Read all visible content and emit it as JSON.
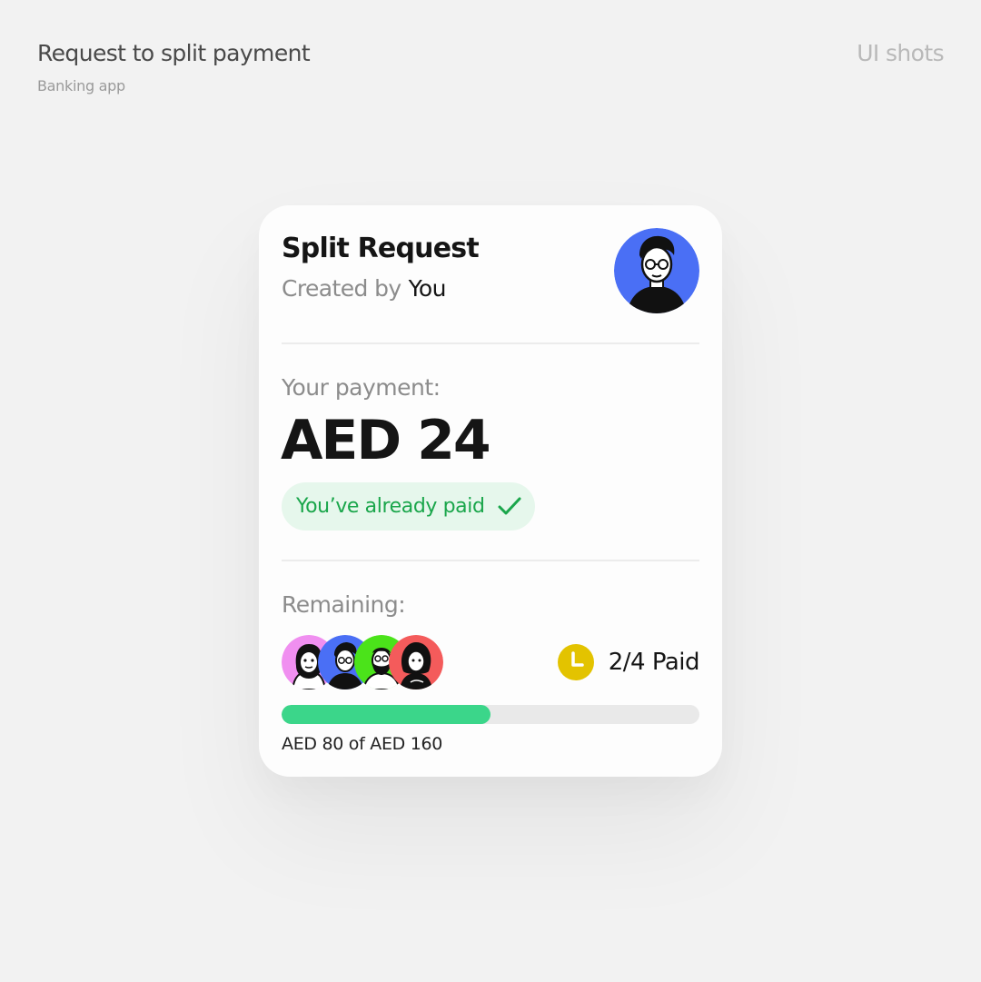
{
  "header": {
    "title": "Request to split payment",
    "subtitle": "Banking app",
    "brand": "UI shots"
  },
  "card": {
    "title": "Split Request",
    "created_by_label": "Created by",
    "created_by_value": "You",
    "owner_avatar_icon": "person-avatar-icon",
    "payment_label": "Your payment:",
    "payment_amount": "AED 24",
    "paid_badge": {
      "text": "You’ve already paid",
      "icon": "check-icon",
      "color": "#1aa64b",
      "background": "#e6f7ec"
    },
    "remaining_label": "Remaining:",
    "participants": [
      {
        "icon": "participant-avatar-icon",
        "color": "#f08ff0"
      },
      {
        "icon": "participant-avatar-icon",
        "color": "#4a6ff5"
      },
      {
        "icon": "participant-avatar-icon",
        "color": "#4be31a"
      },
      {
        "icon": "participant-avatar-icon",
        "color": "#f45b5b"
      }
    ],
    "status": {
      "icon": "clock-icon",
      "icon_color": "#e3c300",
      "text": "2/4 Paid"
    },
    "progress": {
      "fraction": 0.5,
      "color": "#3bd68a",
      "caption": "AED 80 of AED 160"
    }
  }
}
